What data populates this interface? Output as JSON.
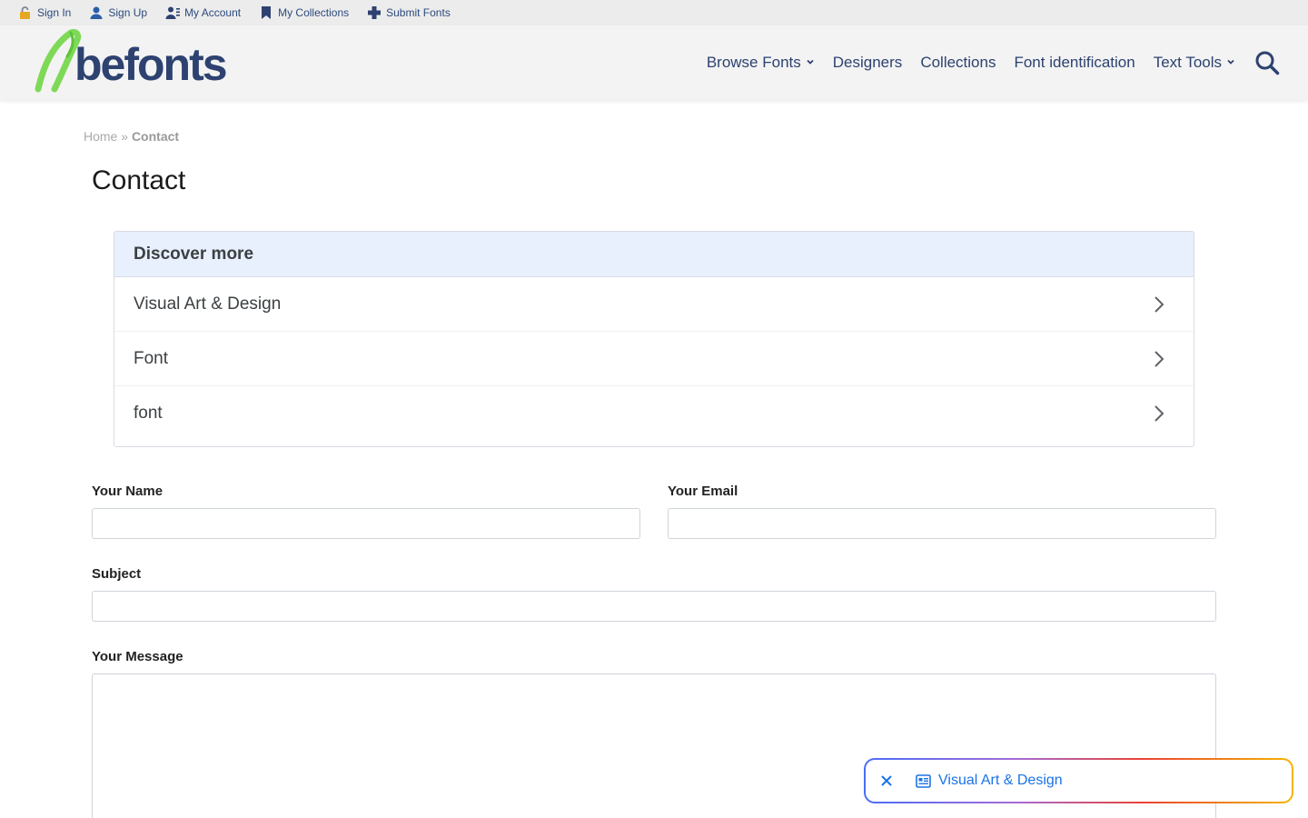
{
  "topbar": {
    "links": [
      {
        "label": "Sign In",
        "icon": "lock-icon"
      },
      {
        "label": "Sign Up",
        "icon": "user-icon"
      },
      {
        "label": "My Account",
        "icon": "account-icon"
      },
      {
        "label": "My Collections",
        "icon": "bookmark-icon"
      },
      {
        "label": "Submit Fonts",
        "icon": "plus-icon"
      }
    ]
  },
  "header": {
    "logo_text": "befonts",
    "nav": [
      {
        "label": "Browse Fonts",
        "has_dropdown": true
      },
      {
        "label": "Designers",
        "has_dropdown": false
      },
      {
        "label": "Collections",
        "has_dropdown": false
      },
      {
        "label": "Font identification",
        "has_dropdown": false
      },
      {
        "label": "Text Tools",
        "has_dropdown": true
      }
    ],
    "search_icon": "search-icon"
  },
  "breadcrumb": {
    "home": "Home",
    "separator": "»",
    "current": "Contact"
  },
  "page": {
    "title": "Contact"
  },
  "discover": {
    "heading": "Discover more",
    "items": [
      "Visual Art & Design",
      "Font",
      "font"
    ]
  },
  "form": {
    "name_label": "Your Name",
    "name_value": "",
    "email_label": "Your Email",
    "email_value": "",
    "subject_label": "Subject",
    "subject_value": "",
    "message_label": "Your Message",
    "message_value": ""
  },
  "chip": {
    "text": "Visual Art & Design"
  },
  "colors": {
    "brand_navy": "#2d4270",
    "brand_green": "#7ed957",
    "discover_header_bg": "#e8effd",
    "chip_text": "#1a73e8"
  }
}
